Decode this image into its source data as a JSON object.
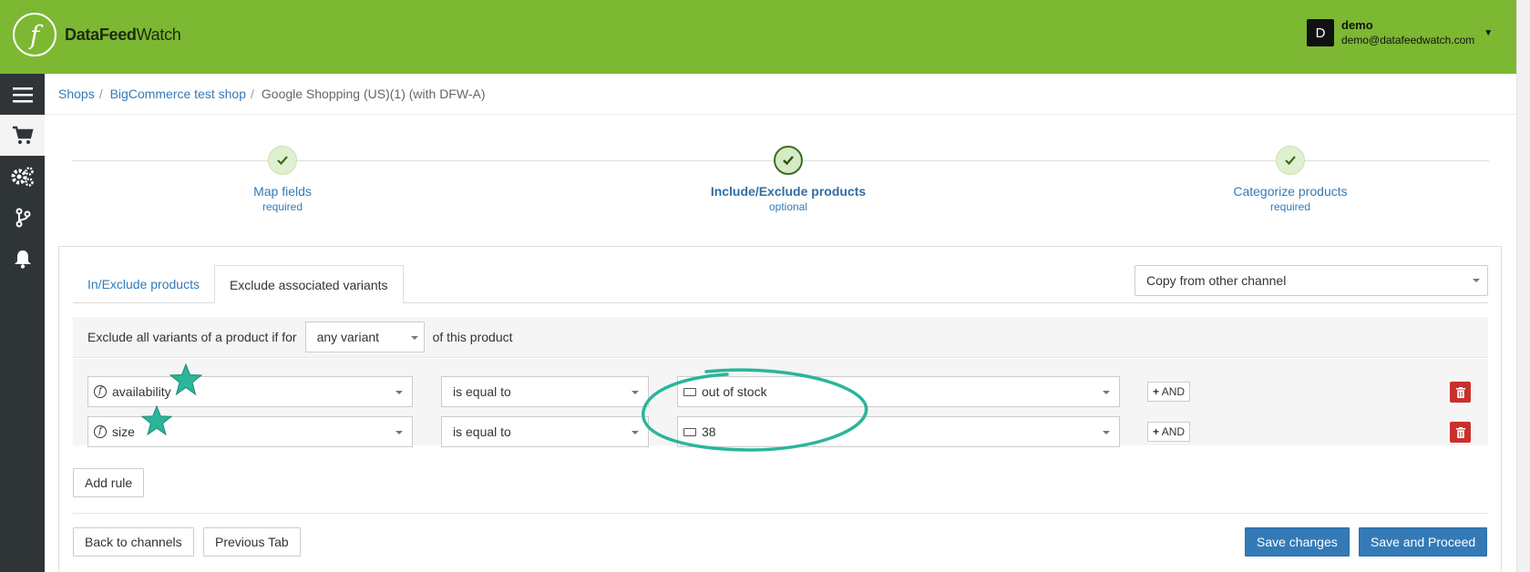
{
  "header": {
    "logo_glyph": "f",
    "brand_bold": "DataFeed",
    "brand_rest": "Watch",
    "user_initial": "D",
    "user_name": "demo",
    "user_email": "demo@datafeedwatch.com",
    "bg_color": "#7cb832"
  },
  "sidebar": {
    "items": [
      {
        "icon": "menu-icon"
      },
      {
        "icon": "cart-icon"
      },
      {
        "icon": "gears-icon"
      },
      {
        "icon": "branch-icon"
      },
      {
        "icon": "bell-icon"
      }
    ]
  },
  "breadcrumb": {
    "items": [
      "Shops",
      "BigCommerce test shop"
    ],
    "separator": "/",
    "current": "Google Shopping (US)(1) (with DFW-A)"
  },
  "steps": [
    {
      "label": "Map fields",
      "sub": "required"
    },
    {
      "label": "Include/Exclude products",
      "sub": "optional"
    },
    {
      "label": "Categorize products",
      "sub": "required"
    }
  ],
  "tabs": [
    "In/Exclude products",
    "Exclude associated variants"
  ],
  "copy_select": "Copy from other channel",
  "rule_header": {
    "prefix": "Exclude all variants of a product if for",
    "variant_value": "any variant",
    "suffix": "of this product"
  },
  "rules": [
    {
      "field": "availability",
      "operator": "is equal to",
      "value": "out of stock",
      "and_label": "AND"
    },
    {
      "field": "size",
      "operator": "is equal to",
      "value": "38",
      "and_label": "AND"
    }
  ],
  "buttons": {
    "add_rule": "Add rule",
    "back": "Back to channels",
    "previous": "Previous Tab",
    "save": "Save changes",
    "save_proceed": "Save and Proceed"
  },
  "colors": {
    "accent": "#337ab7",
    "danger": "#c9302c",
    "annotation": "#2bb59a"
  }
}
